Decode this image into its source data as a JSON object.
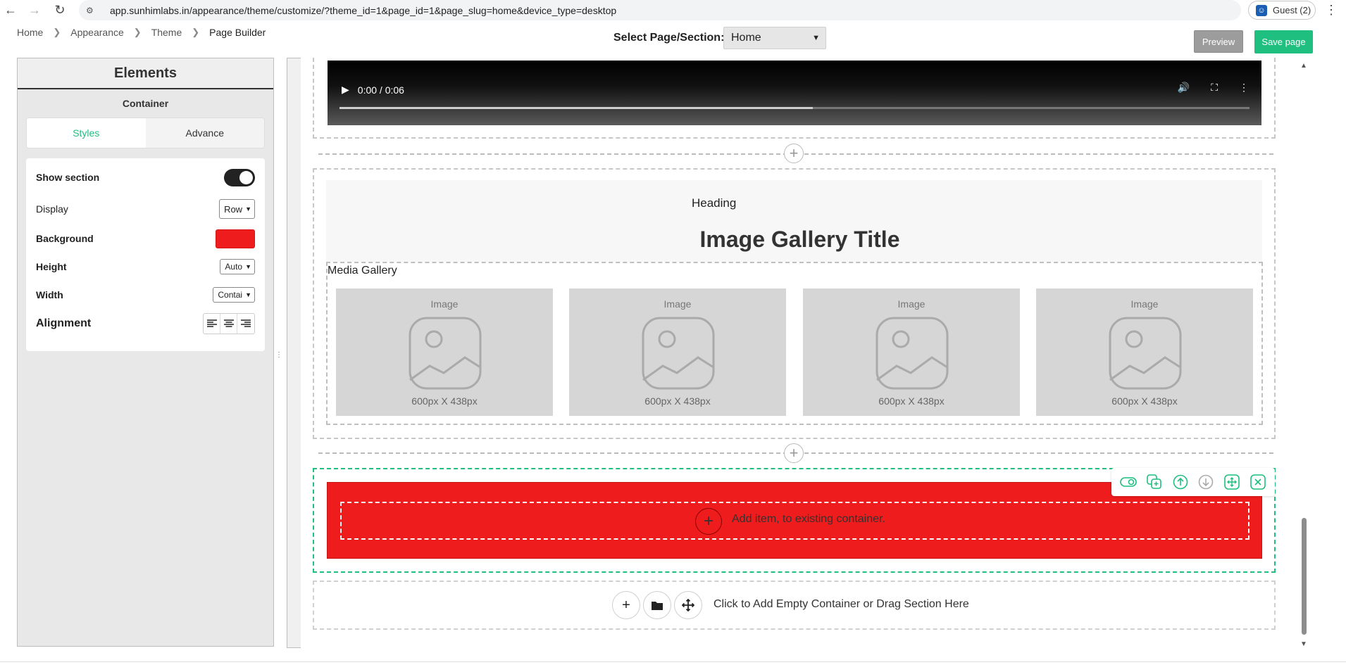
{
  "browser": {
    "url": "app.sunhimlabs.in/appearance/theme/customize/?theme_id=1&page_id=1&page_slug=home&device_type=desktop",
    "profile_label": "Guest (2)"
  },
  "header": {
    "breadcrumb": [
      "Home",
      "Appearance",
      "Theme",
      "Page Builder"
    ],
    "select_label": "Select Page/Section:",
    "selected_page": "Home",
    "preview_label": "Preview",
    "save_label": "Save page"
  },
  "panel": {
    "title": "Elements",
    "subtitle": "Container",
    "tabs": [
      "Styles",
      "Advance"
    ],
    "active_tab": "Styles",
    "props": {
      "show_section": "Show section",
      "display": "Display",
      "display_value": "Row",
      "background": "Background",
      "background_color": "#ee1c1c",
      "height": "Height",
      "height_value": "Auto",
      "width": "Width",
      "width_value": "Contai",
      "alignment": "Alignment"
    }
  },
  "canvas": {
    "video": {
      "time": "0:00 / 0:06",
      "progress": 0.52
    },
    "gallery": {
      "heading": "Heading",
      "title": "Image Gallery Title",
      "media_label": "Media Gallery",
      "images": [
        {
          "caption": "Image",
          "size": "600px X 438px"
        },
        {
          "caption": "Image",
          "size": "600px X 438px"
        },
        {
          "caption": "Image",
          "size": "600px X 438px"
        },
        {
          "caption": "Image",
          "size": "600px X 438px"
        }
      ]
    },
    "active_container": {
      "add_item_text": "Add item, to existing container."
    },
    "empty_container": {
      "text": "Click to Add Empty Container or Drag Section Here"
    }
  },
  "colors": {
    "accent": "#1fbf7f",
    "preview": "#9c9c9c",
    "container_bg": "#ee1c1c"
  }
}
